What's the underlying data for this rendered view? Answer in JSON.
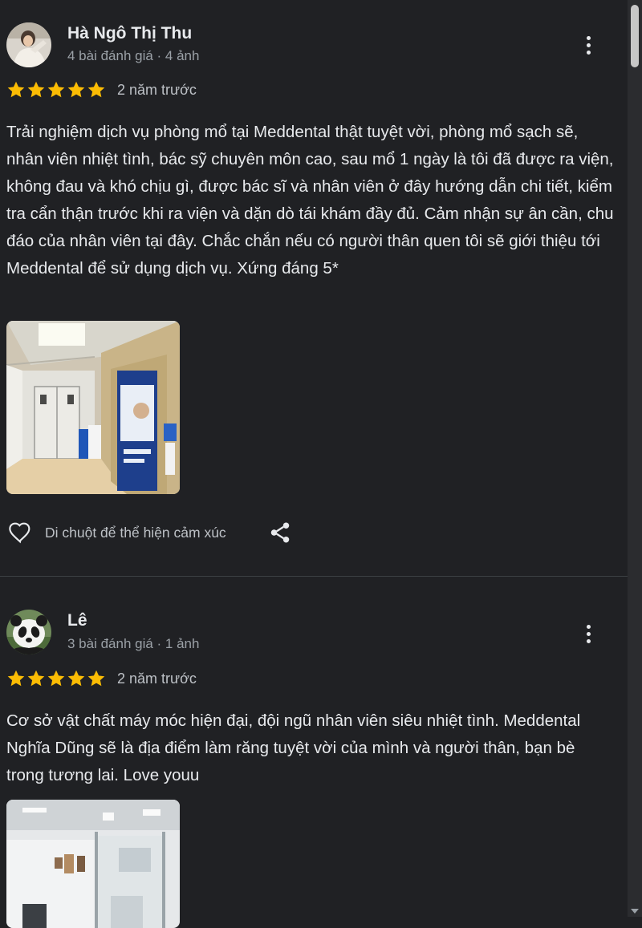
{
  "reviews": [
    {
      "author": "Hà Ngô Thị Thu",
      "meta": "4 bài đánh giá · 4 ảnh",
      "rating": 5,
      "time": "2 năm trước",
      "text": "Trải nghiệm dịch vụ phòng mổ tại Meddental thật tuyệt vời, phòng mổ sạch sẽ, nhân viên nhiệt tình, bác sỹ chuyên môn cao, sau mổ 1 ngày là tôi đã được ra viện, không đau và khó chịu gì, được bác sĩ và nhân viên ở đây hướng dẫn chi tiết, kiểm tra cẩn thận trước khi ra viện và dặn dò tái khám đầy đủ. Cảm nhận sự ân cần, chu đáo của nhân viên tại đây. Chắc chắn nếu có người thân quen tôi sẽ giới thiệu tới Meddental để sử dụng dịch vụ. Xứng đáng 5*",
      "react_label": "Di chuột để thể hiện cảm xúc"
    },
    {
      "author": "Lê",
      "meta": "3 bài đánh giá · 1 ảnh",
      "rating": 5,
      "time": "2 năm trước",
      "text": "Cơ sở vật chất máy móc hiện đại, đội ngũ nhân viên siêu nhiệt tình. Meddental Nghĩa Dũng sẽ là địa điểm làm răng tuyệt vời của mình và người thân, bạn bè trong tương lai. Love youu"
    }
  ],
  "icons": {
    "star": "star-icon",
    "more": "more-vert-icon",
    "heart": "heart-outline-icon",
    "share": "share-icon"
  },
  "colors": {
    "background": "#202124",
    "star": "#fbbc04",
    "text": "#e8eaed",
    "muted": "#9aa0a6"
  }
}
